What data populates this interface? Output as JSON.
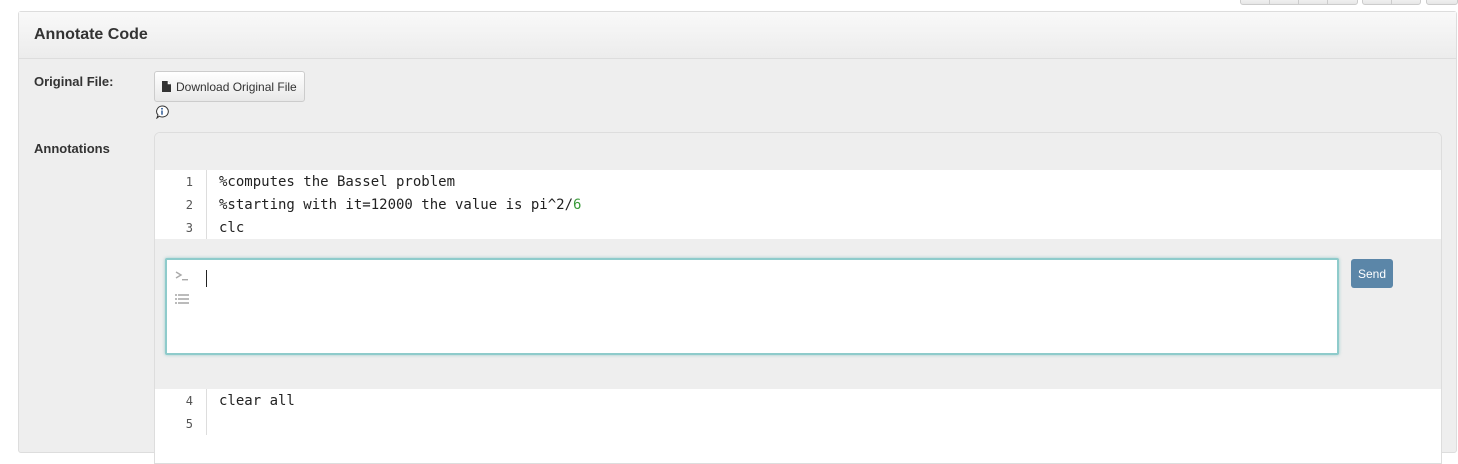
{
  "panel": {
    "title": "Annotate Code"
  },
  "original_file": {
    "label": "Original File:",
    "download_label": "Download Original File"
  },
  "annotations": {
    "label": "Annotations"
  },
  "code": {
    "lines": [
      {
        "num": "1",
        "text": "%computes the Bassel problem"
      },
      {
        "num": "2",
        "text_before": "%starting with it=12000 the value is pi^2/",
        "text_number": "6"
      },
      {
        "num": "3",
        "text": "clc"
      },
      {
        "num": "4",
        "text": "clear all"
      },
      {
        "num": "5",
        "text": ""
      }
    ]
  },
  "comment": {
    "value": "",
    "send_label": "Send"
  },
  "icons": {
    "download": "file-icon",
    "info": "info-icon",
    "prompt": "terminal-prompt-icon",
    "list": "list-icon"
  },
  "colors": {
    "send_button": "#5b86a8",
    "number_literal": "#3a9a3a",
    "comment_border": "#8ecbcb"
  }
}
